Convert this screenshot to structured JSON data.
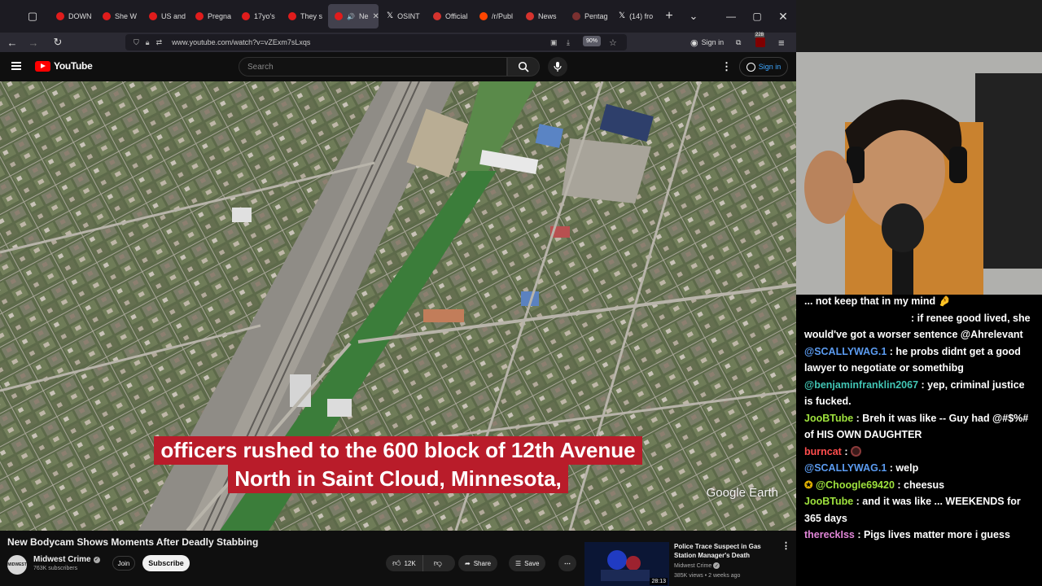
{
  "browser": {
    "tabs": [
      {
        "title": "DOWN",
        "favicon": "youtube-icon"
      },
      {
        "title": "She W",
        "favicon": "youtube-icon"
      },
      {
        "title": "US and",
        "favicon": "youtube-icon"
      },
      {
        "title": "Pregna",
        "favicon": "youtube-icon"
      },
      {
        "title": "17yo's",
        "favicon": "youtube-icon"
      },
      {
        "title": "They s",
        "favicon": "youtube-icon"
      },
      {
        "title": "Ne",
        "favicon": "youtube-icon",
        "active": true
      },
      {
        "title": "OSINT",
        "favicon": "x-icon"
      },
      {
        "title": "Official",
        "favicon": "red-icon"
      },
      {
        "title": "/r/Publ",
        "favicon": "reddit-icon"
      },
      {
        "title": "News",
        "favicon": "red-icon"
      },
      {
        "title": "Pentag",
        "favicon": "pentagon-icon"
      },
      {
        "title": "(14) fro",
        "favicon": "x-icon"
      }
    ],
    "url": "www.youtube.com/watch?v=vZExm7sLxqs",
    "zoom": "90%",
    "sign_in": "Sign in",
    "extension_badge": "228"
  },
  "youtube": {
    "logo_text": "YouTube",
    "search_placeholder": "Search",
    "sign_in": "Sign in"
  },
  "video": {
    "caption_line1": "officers rushed to the 600 block of 12th Avenue",
    "caption_line2": "North in Saint Cloud, Minnesota,",
    "watermark": "Google Earth",
    "title": "New Bodycam Shows Moments After Deadly Stabbing",
    "channel": "Midwest Crime",
    "subscribers": "763K subscribers",
    "join_label": "Join",
    "subscribe_label": "Subscribe",
    "like_count": "12K",
    "share_label": "Share",
    "save_label": "Save"
  },
  "recommended": {
    "title": "Police Trace Suspect in Gas Station Manager's Death",
    "channel": "Midwest Crime",
    "meta": "385K views • 2 weeks ago",
    "duration": "28:13"
  },
  "chat": {
    "messages": [
      {
        "user": "",
        "text": "... not keep that in my mind 🤌"
      },
      {
        "user": "",
        "text": ": if renee good lived, she would've got a worser sentence @Ahrelevant"
      },
      {
        "user": "@SCALLYWAG.1",
        "text": " : he probs didnt get a good lawyer to negotiate or somethibg"
      },
      {
        "user": "@benjaminfranklin2067",
        "text": " : yep, criminal justice is fucked."
      },
      {
        "user": "JooBTube",
        "text": " : Breh it was like -- Guy had @#$%# of HIS OWN DAUGHTER"
      },
      {
        "user": "burncat",
        "text": " : "
      },
      {
        "user": "@SCALLYWAG.1",
        "text": " : welp"
      },
      {
        "user": "@Choogle69420",
        "text": " : cheesus"
      },
      {
        "user": "JooBTube",
        "text": " : and it was like ... WEEKENDS for 365 days"
      },
      {
        "user": "thereckIss",
        "text": " : Pigs lives matter more i guess"
      }
    ]
  },
  "colors": {
    "youtube_red": "#ff0000",
    "caption_bg": "#b91c2a",
    "link_blue": "#3ea6ff"
  }
}
